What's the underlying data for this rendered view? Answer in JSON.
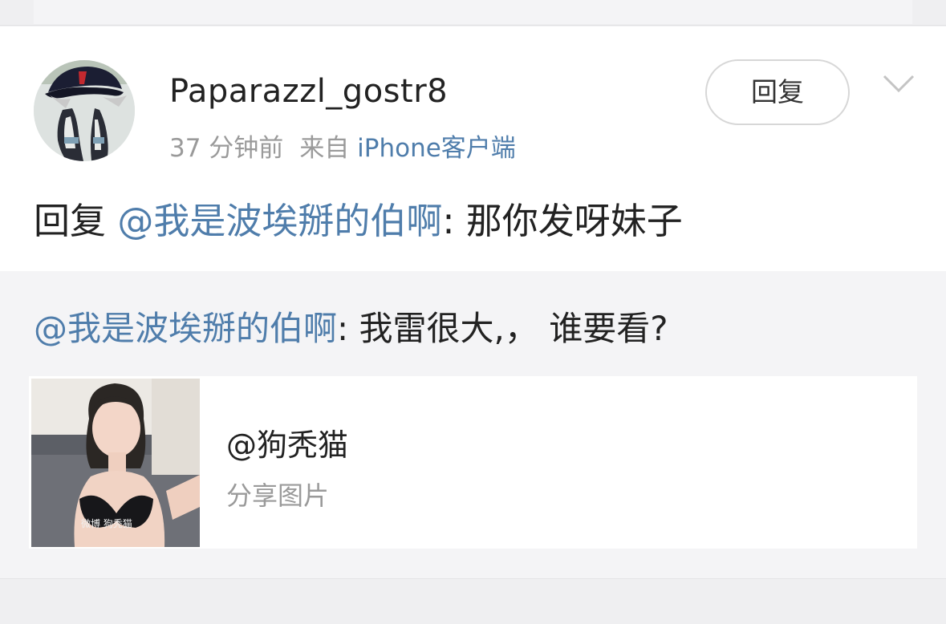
{
  "comment": {
    "username": "Paparazzl_gostr8",
    "time": "37 分钟前",
    "source_prefix": "来自",
    "source_device": "iPhone客户端",
    "reply_button_label": "回复",
    "text_prefix": "回复",
    "mention": "@我是波埃掰的伯啊",
    "text_body": ": 那你发呀妹子"
  },
  "quoted": {
    "mention": "@我是波埃掰的伯啊",
    "text_body": ": 我雷很大,， 谁要看?",
    "share_card": {
      "title": "@狗秃猫",
      "subtitle": "分享图片",
      "watermark": "微博 狗秃猫"
    }
  },
  "icons": {
    "more": "chevron-down-icon"
  },
  "colors": {
    "link": "#4f7dab",
    "text": "#222222",
    "muted": "#9a9a9a",
    "quote_bg": "#f4f4f6"
  }
}
